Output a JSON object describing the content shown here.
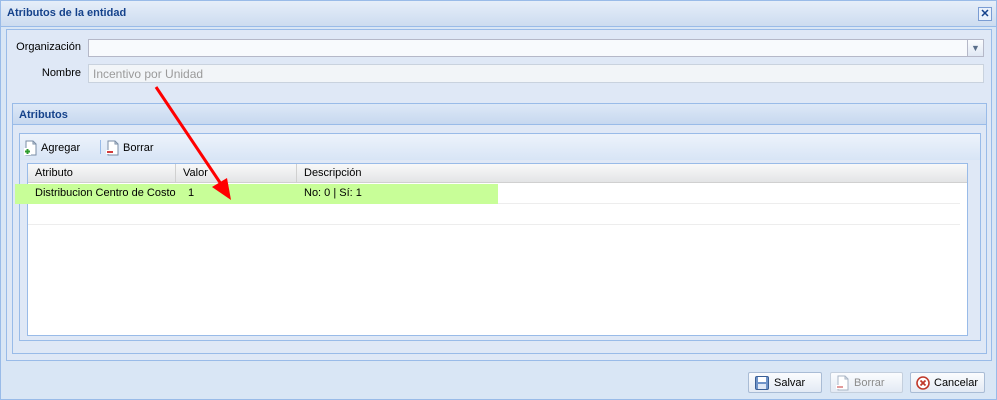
{
  "window": {
    "title": "Atributos de la entidad"
  },
  "form": {
    "org_label": "Organización",
    "org_value": "",
    "name_label": "Nombre",
    "name_value": "Incentivo por Unidad"
  },
  "attributes": {
    "title": "Atributos",
    "toolbar": {
      "add_label": "Agregar",
      "delete_label": "Borrar"
    },
    "columns": [
      "Atributo",
      "Valor",
      "Descripción"
    ],
    "rows": [
      {
        "atributo": "Distribucion Centro de Costo",
        "valor": "1",
        "descripcion": "No: 0 | Sí: 1",
        "highlighted": true
      }
    ]
  },
  "footer": {
    "save_label": "Salvar",
    "delete_label": "Borrar",
    "cancel_label": "Cancelar"
  },
  "colors": {
    "highlight": "#c8fe98",
    "annotation_arrow": "#ff0000",
    "header_text": "#15428b"
  }
}
